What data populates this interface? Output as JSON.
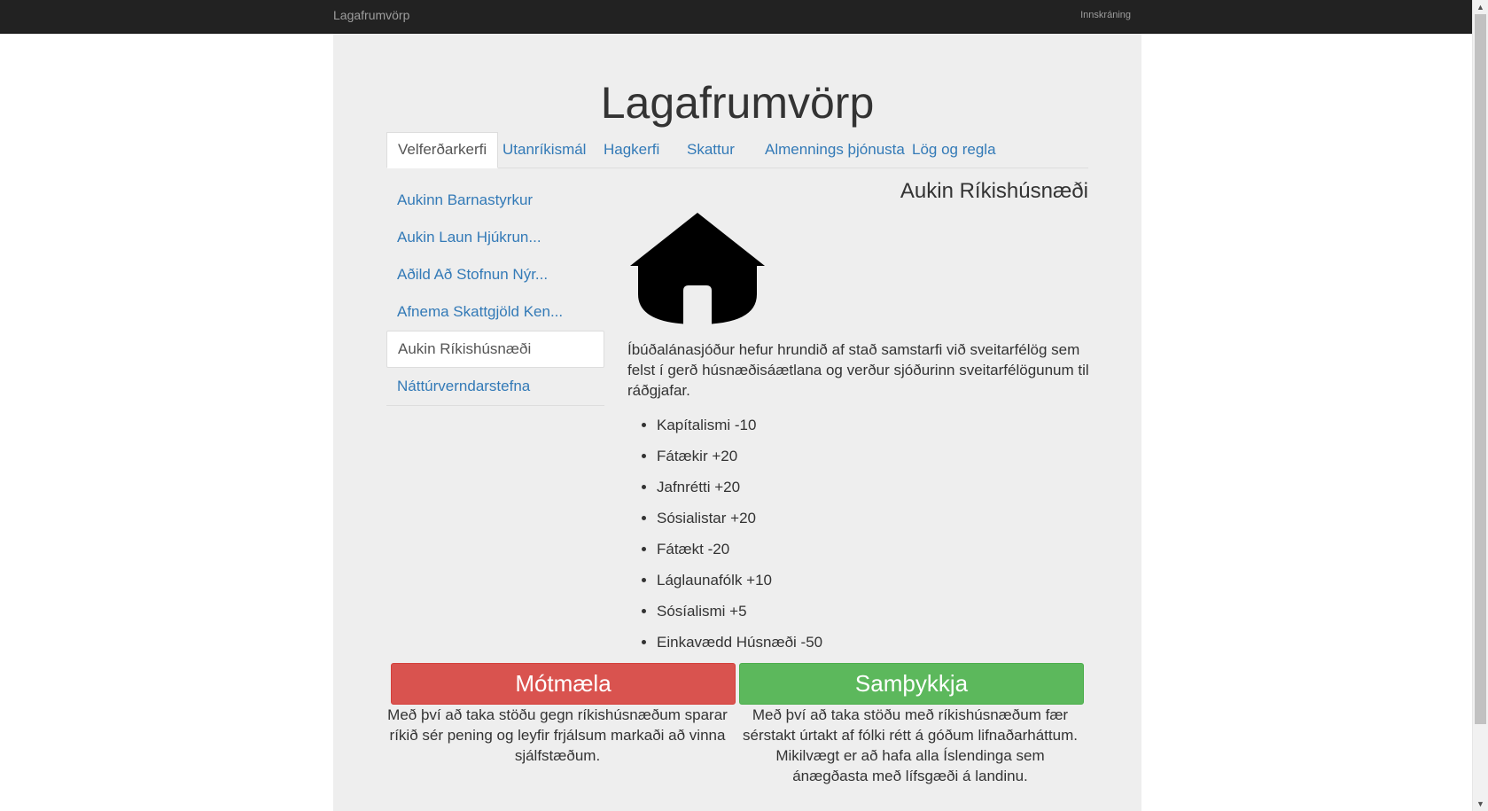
{
  "navbar": {
    "brand": "Lagafrumvörp",
    "login": "Innskráning"
  },
  "page": {
    "title": "Lagafrumvörp"
  },
  "tabs": [
    {
      "label": "Velferðarkerfi",
      "active": true
    },
    {
      "label": "Utanríkismál"
    },
    {
      "label": "Hagkerfi"
    },
    {
      "label": "Skattur"
    },
    {
      "label": "Almennings þjónusta"
    },
    {
      "label": "Lög og regla"
    }
  ],
  "bills": [
    {
      "label": "Aukinn Barnastyrkur"
    },
    {
      "label": "Aukin Laun Hjúkrun..."
    },
    {
      "label": "Aðild Að Stofnun Nýr..."
    },
    {
      "label": "Afnema Skattgjöld Ken..."
    },
    {
      "label": "Aukin Ríkishúsnæði",
      "active": true
    },
    {
      "label": "Náttúrverndarstefna"
    }
  ],
  "detail": {
    "title": "Aukin Ríkishúsnæði",
    "icon": "house-icon",
    "description": "Íbúðalánasjóður hefur hrundið af stað samstarfi við sveitarfélög sem felst í gerð húsnæðisáætlana og verður sjóðurinn sveitarfélögunum til ráðgjafar.",
    "effects": [
      "Kapítalismi -10",
      "Fátækir +20",
      "Jafnrétti +20",
      "Sósialistar +20",
      "Fátækt -20",
      "Láglaunafólk +10",
      "Sósíalismi +5",
      "Einkavædd Húsnæði -50"
    ]
  },
  "actions": {
    "reject_label": "Mótmæla",
    "accept_label": "Samþykkja",
    "reject_text": "Með því að taka stöðu gegn ríkishúsnæðum sparar ríkið sér pening og leyfir frjálsum markaði að vinna sjálfstæðum.",
    "accept_text": "Með því að taka stöðu með ríkishúsnæðum fær sérstakt úrtakt af fólki rétt á góðum lifnaðarháttum. Mikilvægt er að hafa alla Íslendinga sem ánægðasta með lífsgæði á landinu."
  },
  "colors": {
    "navbar_bg": "#222222",
    "container_bg": "#eeeeee",
    "link": "#337ab7",
    "danger": "#d9534f",
    "success": "#5cb85c"
  }
}
